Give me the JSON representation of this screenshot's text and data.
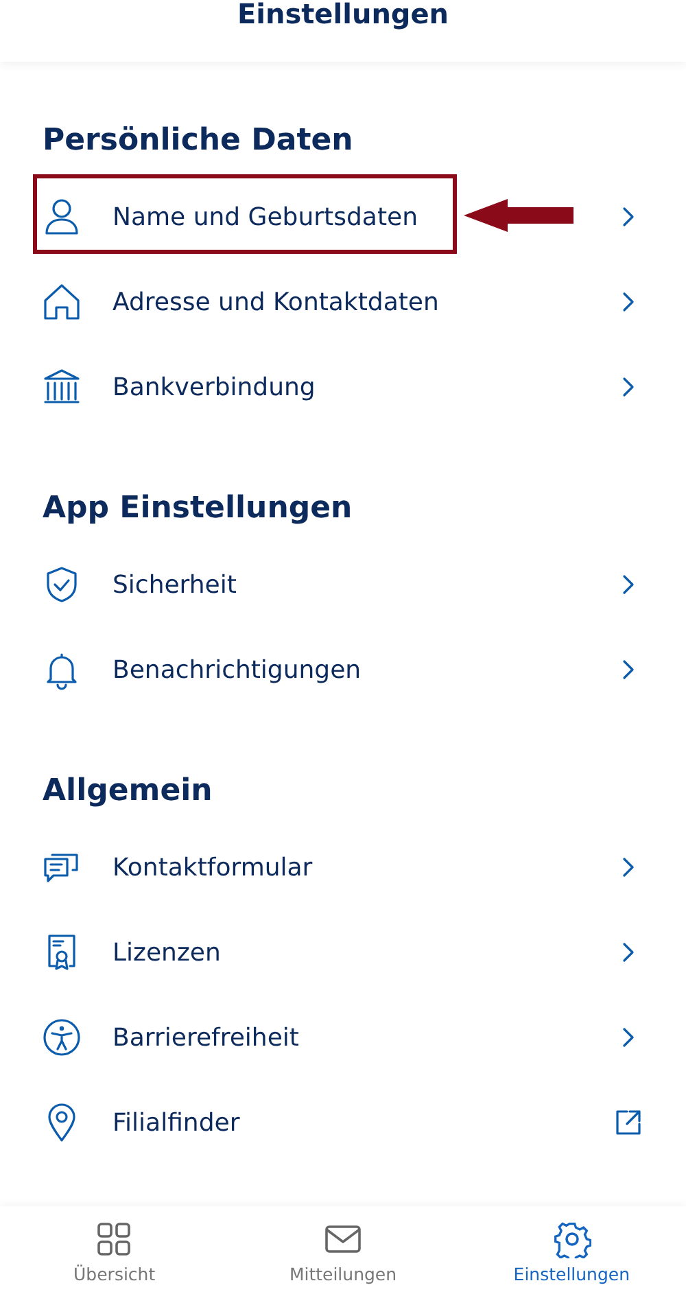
{
  "header": {
    "title": "Einstellungen"
  },
  "sections": [
    {
      "title": "Persönliche Daten",
      "items": [
        {
          "label": "Name und Geburtsdaten",
          "kind": "chevron",
          "highlighted": true
        },
        {
          "label": "Adresse und Kontaktdaten",
          "kind": "chevron",
          "highlighted": false
        },
        {
          "label": "Bankverbindung",
          "kind": "chevron",
          "highlighted": false
        }
      ]
    },
    {
      "title": "App Einstellungen",
      "items": [
        {
          "label": "Sicherheit",
          "kind": "chevron",
          "highlighted": false
        },
        {
          "label": "Benachrichtigungen",
          "kind": "chevron",
          "highlighted": false
        }
      ]
    },
    {
      "title": "Allgemein",
      "items": [
        {
          "label": "Kontaktformular",
          "kind": "chevron",
          "highlighted": false
        },
        {
          "label": "Lizenzen",
          "kind": "chevron",
          "highlighted": false
        },
        {
          "label": "Barrierefreiheit",
          "kind": "chevron",
          "highlighted": false
        },
        {
          "label": "Filialfinder",
          "kind": "external",
          "highlighted": false
        }
      ]
    }
  ],
  "bottom_nav": [
    {
      "label": "Übersicht",
      "selected": false
    },
    {
      "label": "Mitteilungen",
      "selected": false
    },
    {
      "label": "Einstellungen",
      "selected": true
    }
  ]
}
